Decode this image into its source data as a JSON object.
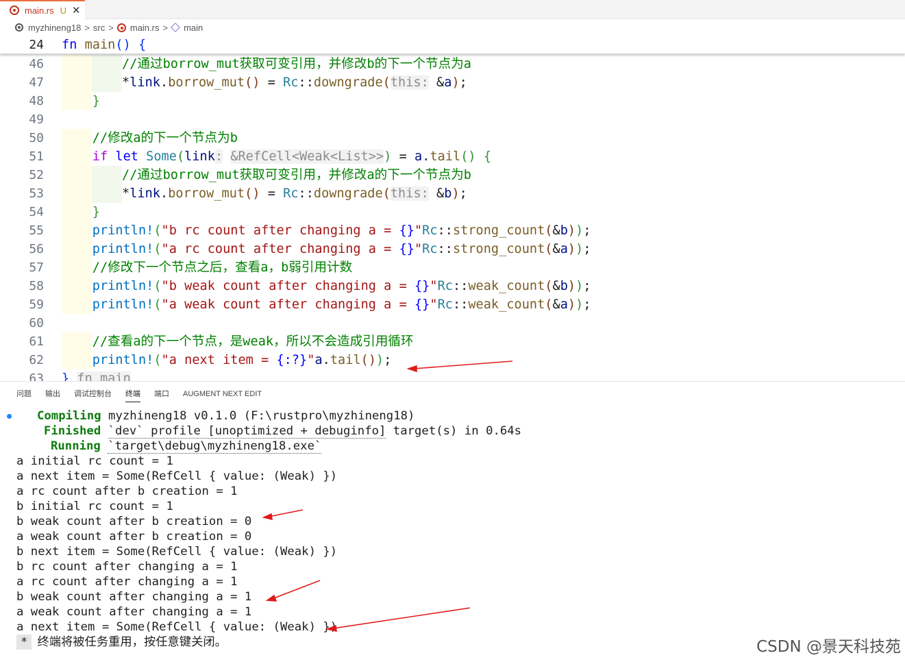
{
  "tab": {
    "name": "main.rs",
    "status": "U",
    "close": "✕"
  },
  "breadcrumb": {
    "project": "myzhineng18",
    "folder": "src",
    "file": "main.rs",
    "symbol": "main",
    "sep": ">"
  },
  "editor": {
    "sticky": {
      "ln": "24",
      "parts": [
        [
          "kw",
          "fn"
        ],
        [
          "",
          " "
        ],
        [
          "fn",
          "main"
        ],
        [
          "br1",
          "()"
        ],
        [
          "",
          " "
        ],
        [
          "br1",
          "{"
        ]
      ]
    },
    "lines": [
      {
        "ln": "46",
        "g": 2,
        "parts": [
          [
            "cmt",
            "//通过borrow_mut获取可变引用，并修改b的下一个节点为a"
          ]
        ]
      },
      {
        "ln": "47",
        "g": 2,
        "parts": [
          [
            "",
            "*"
          ],
          [
            "var",
            "link"
          ],
          [
            "",
            "."
          ],
          [
            "fn",
            "borrow_mut"
          ],
          [
            "br3",
            "()"
          ],
          [
            "",
            " = "
          ],
          [
            "ty",
            "Rc"
          ],
          [
            "",
            "::"
          ],
          [
            "fn",
            "downgrade"
          ],
          [
            "br3",
            "("
          ],
          [
            "hint",
            "this:"
          ],
          [
            "",
            " &"
          ],
          [
            "var",
            "a"
          ],
          [
            "br3",
            ")"
          ],
          [
            "",
            ";"
          ]
        ]
      },
      {
        "ln": "48",
        "g": 1,
        "parts": [
          [
            "",
            "    "
          ],
          [
            "br2",
            "}"
          ]
        ]
      },
      {
        "ln": "49",
        "g": 0,
        "parts": []
      },
      {
        "ln": "50",
        "g": 1,
        "parts": [
          [
            "",
            "    "
          ],
          [
            "cmt",
            "//修改a的下一个节点为b"
          ]
        ]
      },
      {
        "ln": "51",
        "g": 1,
        "parts": [
          [
            "",
            "    "
          ],
          [
            "kw2",
            "if"
          ],
          [
            "",
            " "
          ],
          [
            "kw",
            "let"
          ],
          [
            "",
            " "
          ],
          [
            "ty",
            "Some"
          ],
          [
            "br2",
            "("
          ],
          [
            "var",
            "link"
          ],
          [
            "hint",
            ":"
          ],
          [
            "",
            " "
          ],
          [
            "hint",
            "&RefCell<Weak<List>>"
          ],
          [
            "br2",
            ")"
          ],
          [
            "",
            " = "
          ],
          [
            "var",
            "a"
          ],
          [
            "",
            "."
          ],
          [
            "fn",
            "tail"
          ],
          [
            "br2",
            "()"
          ],
          [
            "",
            " "
          ],
          [
            "br2",
            "{"
          ]
        ]
      },
      {
        "ln": "52",
        "g": 2,
        "parts": [
          [
            "cmt",
            "//通过borrow_mut获取可变引用，并修改a的下一个节点为b"
          ]
        ]
      },
      {
        "ln": "53",
        "g": 2,
        "parts": [
          [
            "",
            "*"
          ],
          [
            "var",
            "link"
          ],
          [
            "",
            "."
          ],
          [
            "fn",
            "borrow_mut"
          ],
          [
            "br3",
            "()"
          ],
          [
            "",
            " = "
          ],
          [
            "ty",
            "Rc"
          ],
          [
            "",
            "::"
          ],
          [
            "fn",
            "downgrade"
          ],
          [
            "br3",
            "("
          ],
          [
            "hint",
            "this:"
          ],
          [
            "",
            " &"
          ],
          [
            "var",
            "b"
          ],
          [
            "br3",
            ")"
          ],
          [
            "",
            ";"
          ]
        ]
      },
      {
        "ln": "54",
        "g": 1,
        "parts": [
          [
            "",
            "    "
          ],
          [
            "br2",
            "}"
          ]
        ]
      },
      {
        "ln": "55",
        "g": 1,
        "parts": [
          [
            "",
            "    "
          ],
          [
            "mac",
            "println!"
          ],
          [
            "br2",
            "("
          ],
          [
            "str",
            "\"b rc count after changing a = "
          ],
          [
            "fmt",
            "{}"
          ],
          [
            "str",
            "\""
          ],
          [
            ", "
          ],
          [
            "ty",
            "Rc"
          ],
          [
            "",
            "::"
          ],
          [
            "fn",
            "strong_count"
          ],
          [
            "br3",
            "("
          ],
          [
            "",
            "&"
          ],
          [
            "var",
            "b"
          ],
          [
            "br3",
            ")"
          ],
          [
            "br2",
            ")"
          ],
          [
            "",
            ";"
          ]
        ]
      },
      {
        "ln": "56",
        "g": 1,
        "parts": [
          [
            "",
            "    "
          ],
          [
            "mac",
            "println!"
          ],
          [
            "br2",
            "("
          ],
          [
            "str",
            "\"a rc count after changing a = "
          ],
          [
            "fmt",
            "{}"
          ],
          [
            "str",
            "\""
          ],
          [
            ", "
          ],
          [
            "ty",
            "Rc"
          ],
          [
            "",
            "::"
          ],
          [
            "fn",
            "strong_count"
          ],
          [
            "br3",
            "("
          ],
          [
            "",
            "&"
          ],
          [
            "var",
            "a"
          ],
          [
            "br3",
            ")"
          ],
          [
            "br2",
            ")"
          ],
          [
            "",
            ";"
          ]
        ]
      },
      {
        "ln": "57",
        "g": 1,
        "parts": [
          [
            "",
            "    "
          ],
          [
            "cmt",
            "//修改下一个节点之后，查看a，b弱引用计数"
          ]
        ]
      },
      {
        "ln": "58",
        "g": 1,
        "parts": [
          [
            "",
            "    "
          ],
          [
            "mac",
            "println!"
          ],
          [
            "br2",
            "("
          ],
          [
            "str",
            "\"b weak count after changing a = "
          ],
          [
            "fmt",
            "{}"
          ],
          [
            "str",
            "\""
          ],
          [
            ", "
          ],
          [
            "ty",
            "Rc"
          ],
          [
            "",
            "::"
          ],
          [
            "fn",
            "weak_count"
          ],
          [
            "br3",
            "("
          ],
          [
            "",
            "&"
          ],
          [
            "var",
            "b"
          ],
          [
            "br3",
            ")"
          ],
          [
            "br2",
            ")"
          ],
          [
            "",
            ";"
          ]
        ]
      },
      {
        "ln": "59",
        "g": 1,
        "parts": [
          [
            "",
            "    "
          ],
          [
            "mac",
            "println!"
          ],
          [
            "br2",
            "("
          ],
          [
            "str",
            "\"a weak count after changing a = "
          ],
          [
            "fmt",
            "{}"
          ],
          [
            "str",
            "\""
          ],
          [
            ", "
          ],
          [
            "ty",
            "Rc"
          ],
          [
            "",
            "::"
          ],
          [
            "fn",
            "weak_count"
          ],
          [
            "br3",
            "("
          ],
          [
            "",
            "&"
          ],
          [
            "var",
            "a"
          ],
          [
            "br3",
            ")"
          ],
          [
            "br2",
            ")"
          ],
          [
            "",
            ";"
          ]
        ]
      },
      {
        "ln": "60",
        "g": 0,
        "parts": []
      },
      {
        "ln": "61",
        "g": 1,
        "parts": [
          [
            "",
            "    "
          ],
          [
            "cmt",
            "//查看a的下一个节点，是weak，所以不会造成引用循环"
          ]
        ]
      },
      {
        "ln": "62",
        "g": 1,
        "parts": [
          [
            "",
            "    "
          ],
          [
            "mac",
            "println!"
          ],
          [
            "br2",
            "("
          ],
          [
            "str",
            "\"a next item = "
          ],
          [
            "fmt",
            "{:?}"
          ],
          [
            "str",
            "\""
          ],
          [
            ", "
          ],
          [
            "var",
            "a"
          ],
          [
            "",
            "."
          ],
          [
            "fn",
            "tail"
          ],
          [
            "br3",
            "()"
          ],
          [
            "br2",
            ")"
          ],
          [
            "",
            ";"
          ]
        ]
      },
      {
        "ln": "63",
        "g": 0,
        "parts": [
          [
            "br1",
            "}"
          ],
          [
            "",
            " "
          ],
          [
            "hint",
            "fn main"
          ]
        ]
      }
    ]
  },
  "panel": {
    "tabs": [
      "问题",
      "输出",
      "调试控制台",
      "终端",
      "端口",
      "AUGMENT NEXT EDIT"
    ],
    "active_tab": "终端"
  },
  "terminal": {
    "compiling_label": "Compiling",
    "compiling_text": " myzhineng18 v0.1.0 (F:\\rustpro\\myzhineng18)",
    "finished_label": "Finished",
    "finished_tick": "`dev` profile [unoptimized + debuginfo]",
    "finished_text": " target(s) in 0.64s",
    "running_label": "Running",
    "running_text": "`target\\debug\\myzhineng18.exe`",
    "output": [
      "a initial rc count = 1",
      "a next item = Some(RefCell { value: (Weak) })",
      "a rc count after b creation = 1",
      "b initial rc count = 1",
      "b weak count after b creation = 0",
      "a weak count after b creation = 0",
      "b next item = Some(RefCell { value: (Weak) })",
      "b rc count after changing a = 1",
      "a rc count after changing a = 1",
      "b weak count after changing a = 1",
      "a weak count after changing a = 1",
      "a next item = Some(RefCell { value: (Weak) })"
    ],
    "prompt_marker": "*",
    "prompt_text": "终端将被任务重用，按任意键关闭。"
  },
  "watermark": "CSDN @景天科技苑"
}
